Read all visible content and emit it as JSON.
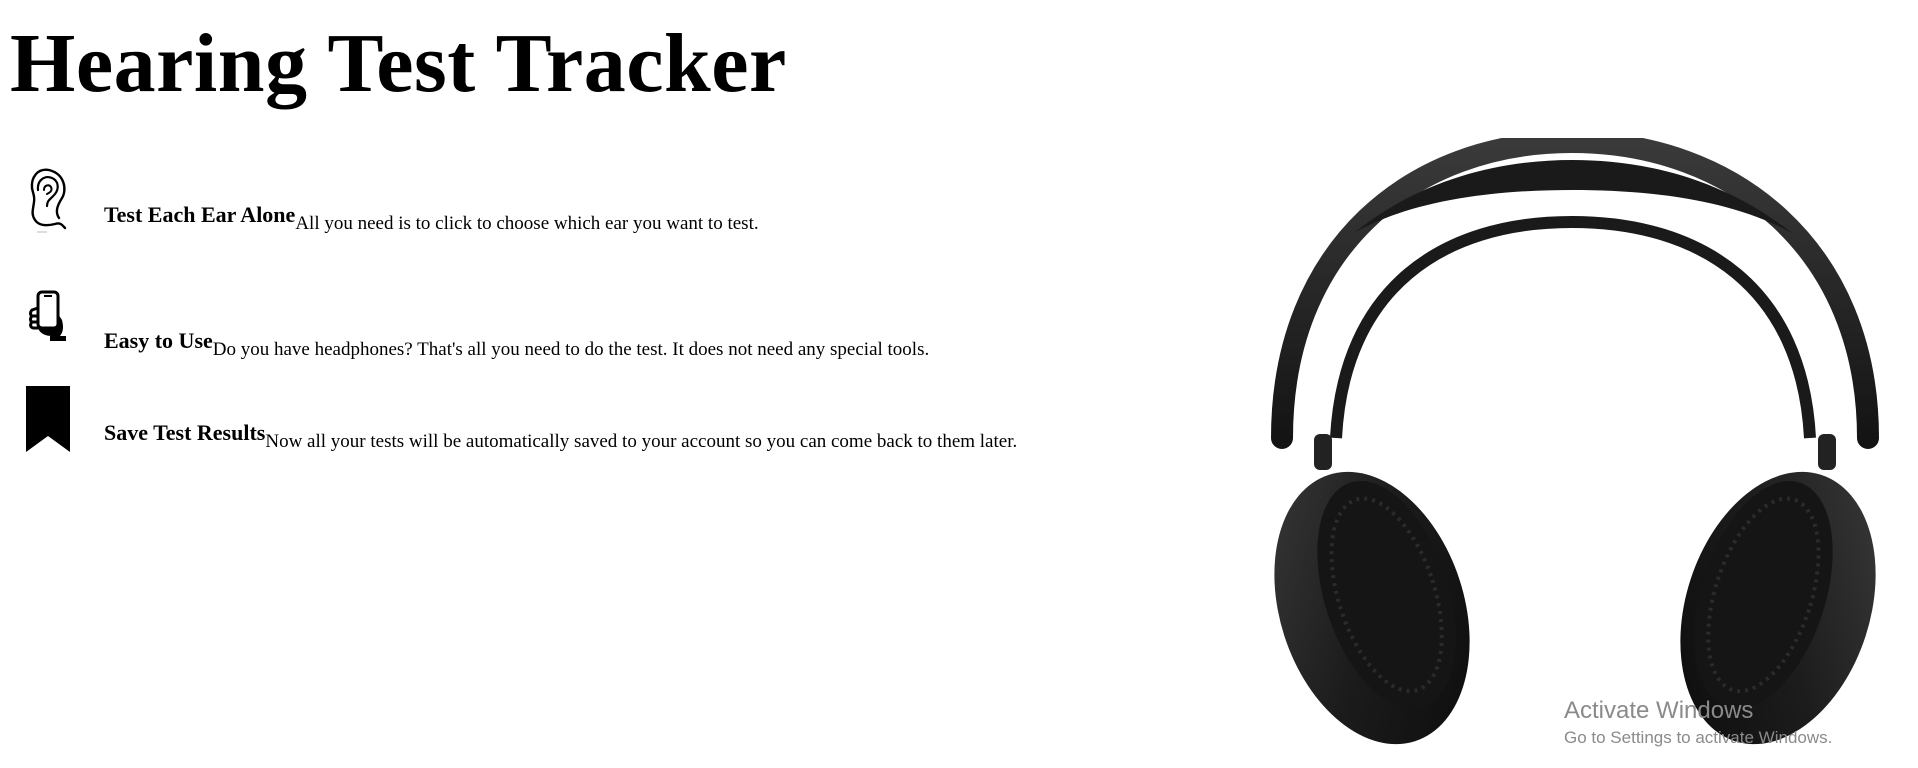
{
  "page": {
    "title": "Hearing Test Tracker"
  },
  "features": [
    {
      "icon": "ear-icon",
      "title": "Test Each Ear Alone",
      "description": "All you need is to click to choose which ear you want to test."
    },
    {
      "icon": "smartphone-hand-icon",
      "title": "Easy to Use",
      "description": "Do you have headphones? That's all you need to do the test. It does not need any special tools."
    },
    {
      "icon": "bookmark-icon",
      "title": "Save Test Results",
      "description": "Now all your tests will be automatically saved to your account so you can come back to them later."
    }
  ],
  "hero_image": {
    "subject": "headphones",
    "color": "#1c1c1c"
  },
  "watermark": {
    "title": "Activate Windows",
    "subtitle": "Go to Settings to activate Windows."
  }
}
